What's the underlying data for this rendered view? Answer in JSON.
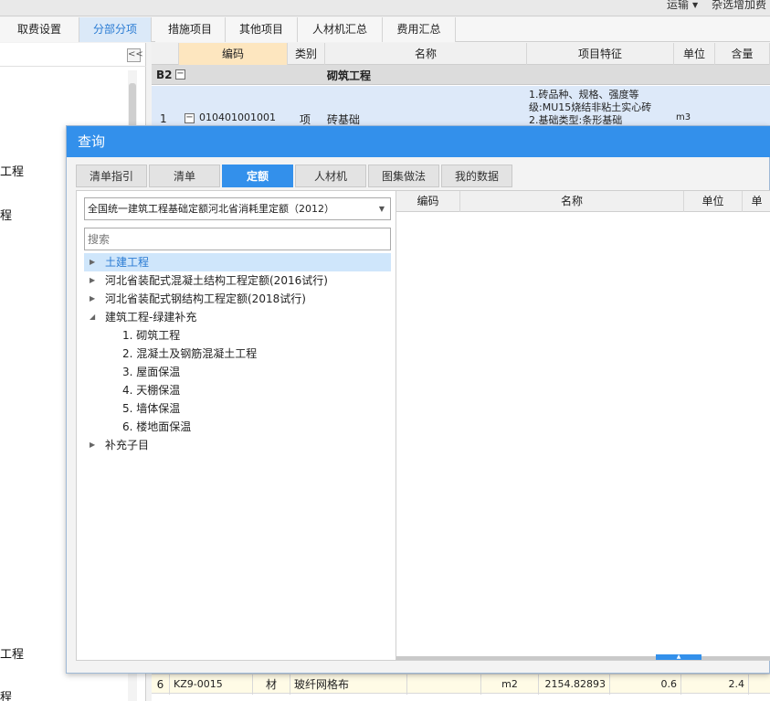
{
  "topbar": {
    "item1": "运输",
    "item2": "杂选增加费"
  },
  "main_tabs": [
    "取费设置",
    "分部分项",
    "措施项目",
    "其他项目",
    "人材机汇总",
    "费用汇总"
  ],
  "main_tabs_active": "分部分项",
  "sidebar": {
    "collapse_label": "<<",
    "frags": [
      "工程",
      "程",
      "工程",
      "程"
    ]
  },
  "grid": {
    "columns": [
      "编码",
      "类别",
      "名称",
      "项目特征",
      "单位",
      "含量"
    ],
    "row_b2": {
      "id": "B2",
      "name": "砌筑工程"
    },
    "row_1": {
      "index": "1",
      "code": "010401001001",
      "type": "项",
      "name": "砖基础",
      "feature_lines": [
        "1.砖品种、规格、强度等",
        "级:MU15烧结非粘土实心砖",
        "2.基础类型:条形基础"
      ],
      "unit": "m3"
    },
    "row_6": {
      "index": "6",
      "code": "KZ9-0015",
      "type": "材",
      "name": "玻纤网格布",
      "unit": "m2",
      "value1": "2154.82893",
      "value2": "0.6",
      "value3": "2.4"
    }
  },
  "dialog": {
    "title": "查询",
    "tabs": [
      "清单指引",
      "清单",
      "定额",
      "人材机",
      "图集做法",
      "我的数据"
    ],
    "active_tab": "定额",
    "quota_select": "全国统一建筑工程基础定额河北省消耗里定额（2012）",
    "search_placeholder": "搜索",
    "tree": [
      {
        "label": "土建工程",
        "selected": true,
        "arrow": "right",
        "child": false
      },
      {
        "label": "河北省装配式混凝土结构工程定额(2016试行)",
        "selected": false,
        "arrow": "right",
        "child": false
      },
      {
        "label": "河北省装配式钢结构工程定额(2018试行)",
        "selected": false,
        "arrow": "right",
        "child": false
      },
      {
        "label": "建筑工程-绿建补充",
        "selected": false,
        "arrow": "down",
        "child": false
      },
      {
        "label": "1. 砌筑工程",
        "selected": false,
        "arrow": "",
        "child": true
      },
      {
        "label": "2. 混凝土及钢筋混凝土工程",
        "selected": false,
        "arrow": "",
        "child": true
      },
      {
        "label": "3. 屋面保温",
        "selected": false,
        "arrow": "",
        "child": true
      },
      {
        "label": "4. 天棚保温",
        "selected": false,
        "arrow": "",
        "child": true
      },
      {
        "label": "5. 墙体保温",
        "selected": false,
        "arrow": "",
        "child": true
      },
      {
        "label": "6. 楼地面保温",
        "selected": false,
        "arrow": "",
        "child": true
      },
      {
        "label": "补充子目",
        "selected": false,
        "arrow": "right",
        "child": false
      }
    ],
    "result_columns": [
      "编码",
      "名称",
      "单位",
      "单"
    ]
  },
  "colors": {
    "accent": "#3390eb",
    "selected_row": "#dde9f9",
    "header_active": "#fde6bf"
  }
}
